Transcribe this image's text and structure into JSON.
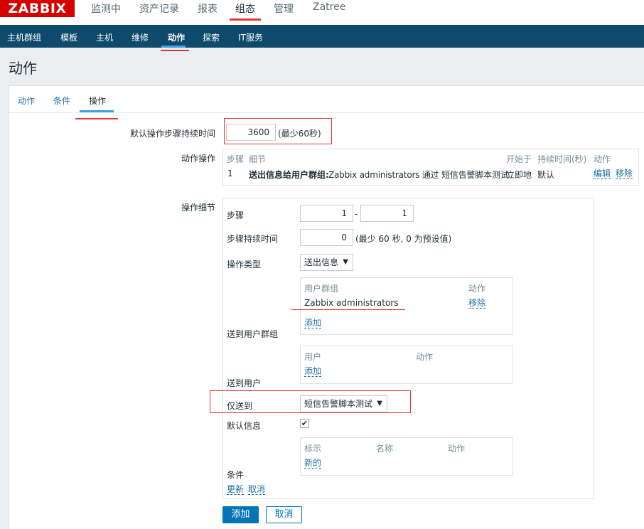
{
  "header": {
    "logo": "ZABBIX",
    "nav": [
      "监测中",
      "资产记录",
      "报表",
      "组态",
      "管理",
      "Zatree"
    ],
    "active_nav": "组态"
  },
  "subnav": {
    "items": [
      "主机群组",
      "模板",
      "主机",
      "维修",
      "动作",
      "探索",
      "IT服务"
    ],
    "active": "动作"
  },
  "page_title": "动作",
  "tabs": {
    "items": [
      "动作",
      "条件",
      "操作"
    ],
    "active": "操作"
  },
  "default_step_duration": {
    "label": "默认操作步骤持续时间",
    "value": "3600",
    "hint": "(最少60秒)"
  },
  "operations": {
    "label": "动作操作",
    "headers": {
      "step": "步骤",
      "details": "细节",
      "start_in": "开始于",
      "duration": "持续时间(秒)",
      "action": "动作"
    },
    "rows": [
      {
        "step": "1",
        "details_bold": "送出信息给用户群组:",
        "details_rest": " Zabbix administrators 通过 短信告警脚本测试",
        "start_in": "立即地",
        "duration": "默认",
        "edit": "编辑",
        "remove": "移除"
      }
    ]
  },
  "op_details": {
    "label": "操作细节",
    "steps_label": "步骤",
    "step_from": "1",
    "step_sep": "-",
    "step_to": "1",
    "duration_label": "步骤持续时间",
    "duration_value": "0",
    "duration_hint": "(最少 60 秒, 0 为预设值)",
    "type_label": "操作类型",
    "type_value": "送出信息",
    "send_groups_label": "送到用户群组",
    "groups_col_group": "用户群组",
    "groups_col_action": "动作",
    "group_name": "Zabbix administrators",
    "group_remove": "移除",
    "groups_add": "添加",
    "send_users_label": "送到用户",
    "users_col_user": "用户",
    "users_col_action": "动作",
    "users_add": "添加",
    "send_only_label": "仅送到",
    "send_only_value": "短信告警脚本测试",
    "default_msg_label": "默认信息",
    "default_msg_checked": true,
    "conditions_label": "条件",
    "cond_col_label": "标示",
    "cond_col_name": "名称",
    "cond_col_action": "动作",
    "cond_new": "新的",
    "update": "更新",
    "cancel_link": "取消"
  },
  "buttons": {
    "add": "添加",
    "cancel": "取消"
  },
  "colors": {
    "logo_red": "#d40000",
    "nav_dark_blue": "#0e4a6c",
    "link_blue": "#1f6ea4",
    "primary_button": "#0275b8",
    "highlight_red": "#e33734"
  }
}
